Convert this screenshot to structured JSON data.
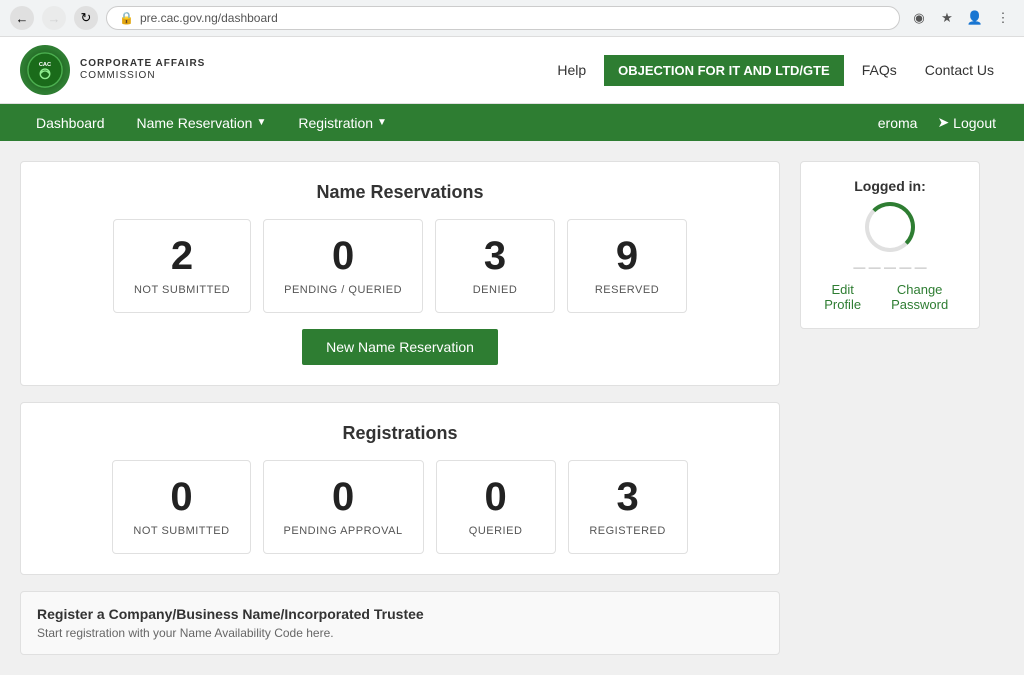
{
  "browser": {
    "url": "pre.cac.gov.ng/dashboard",
    "back_disabled": false,
    "forward_disabled": true
  },
  "header": {
    "logo_company": "CORPORATE AFFAIRS",
    "logo_affairs": "AFFAIRS",
    "logo_commission": "COMMISSION",
    "nav_help": "Help",
    "nav_objection": "OBJECTION FOR IT AND LTD/GTE",
    "nav_faqs": "FAQs",
    "nav_contact": "Contact Us"
  },
  "main_nav": {
    "dashboard": "Dashboard",
    "name_reservation": "Name Reservation",
    "registration": "Registration",
    "user": "eroma",
    "logout": "Logout"
  },
  "name_reservations": {
    "title": "Name Reservations",
    "stats": [
      {
        "number": "2",
        "label": "NOT SUBMITTED"
      },
      {
        "number": "0",
        "label": "PENDING / QUERIED"
      },
      {
        "number": "3",
        "label": "DENIED"
      },
      {
        "number": "9",
        "label": "RESERVED"
      }
    ],
    "new_button": "New Name Reservation"
  },
  "registrations": {
    "title": "Registrations",
    "stats": [
      {
        "number": "0",
        "label": "NOT SUBMITTED"
      },
      {
        "number": "0",
        "label": "PENDING APPROVAL"
      },
      {
        "number": "0",
        "label": "QUERIED"
      },
      {
        "number": "3",
        "label": "REGISTERED"
      }
    ]
  },
  "register_card": {
    "title": "Register a Company/Business Name/Incorporated Trustee",
    "subtitle": "Start registration with your Name Availability Code here."
  },
  "logged_in_panel": {
    "title": "Logged in:",
    "edit_profile": "Edit Profile",
    "change_password": "Change Password"
  }
}
